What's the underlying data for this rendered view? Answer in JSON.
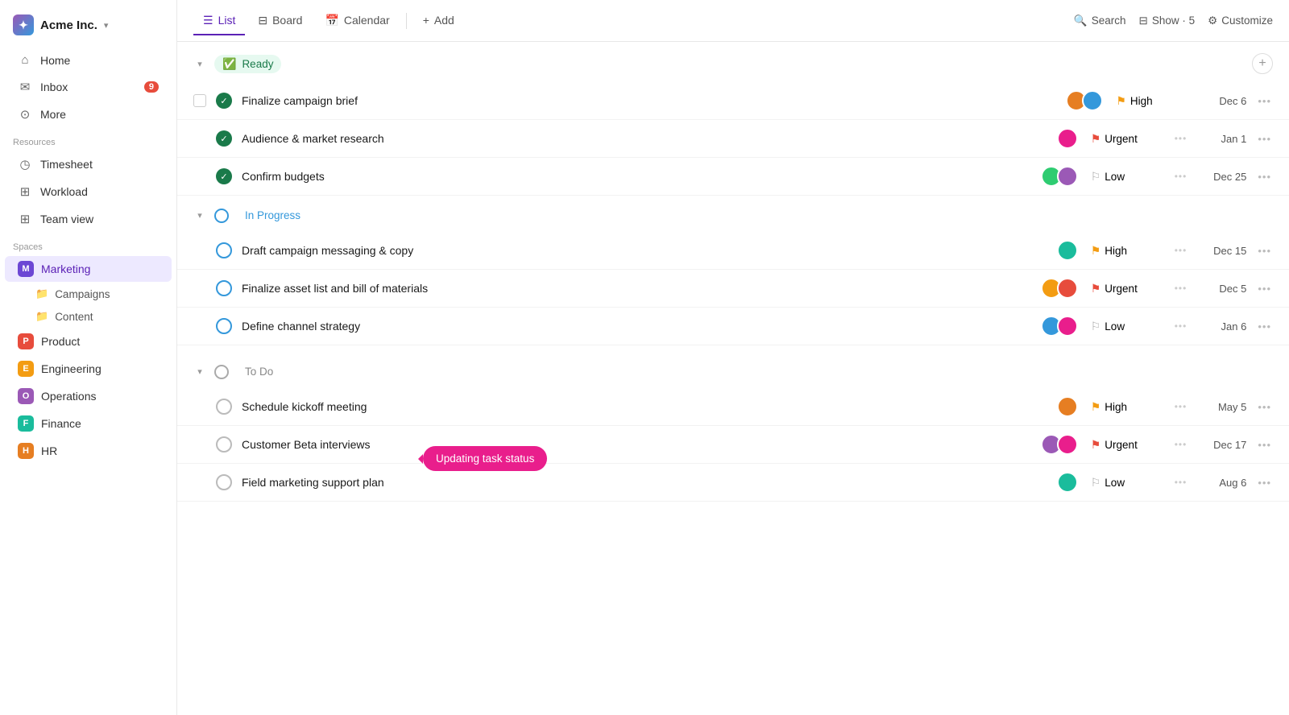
{
  "app": {
    "brand": "Acme Inc.",
    "brand_chevron": "▾"
  },
  "sidebar": {
    "nav_items": [
      {
        "id": "home",
        "label": "Home",
        "icon": "⌂"
      },
      {
        "id": "inbox",
        "label": "Inbox",
        "icon": "✉",
        "badge": "9"
      },
      {
        "id": "more",
        "label": "More",
        "icon": "⊙"
      }
    ],
    "resources_label": "Resources",
    "resource_items": [
      {
        "id": "timesheet",
        "label": "Timesheet",
        "icon": "◷"
      },
      {
        "id": "workload",
        "label": "Workload",
        "icon": "⊞"
      },
      {
        "id": "team-view",
        "label": "Team view",
        "icon": "⊞"
      }
    ],
    "spaces_label": "Spaces",
    "spaces": [
      {
        "id": "marketing",
        "label": "Marketing",
        "letter": "M",
        "color": "#6c47d4",
        "active": true
      },
      {
        "id": "product",
        "label": "Product",
        "letter": "P",
        "color": "#e74c3c"
      },
      {
        "id": "engineering",
        "label": "Engineering",
        "letter": "E",
        "color": "#f39c12"
      },
      {
        "id": "operations",
        "label": "Operations",
        "letter": "O",
        "color": "#9b59b6"
      },
      {
        "id": "finance",
        "label": "Finance",
        "letter": "F",
        "color": "#1abc9c"
      },
      {
        "id": "hr",
        "label": "HR",
        "letter": "H",
        "color": "#e67e22"
      }
    ],
    "sub_items": [
      {
        "id": "campaigns",
        "label": "Campaigns"
      },
      {
        "id": "content",
        "label": "Content"
      }
    ]
  },
  "topnav": {
    "tabs": [
      {
        "id": "list",
        "label": "List",
        "active": true
      },
      {
        "id": "board",
        "label": "Board",
        "active": false
      },
      {
        "id": "calendar",
        "label": "Calendar",
        "active": false
      }
    ],
    "add_label": "Add",
    "search_label": "Search",
    "show_label": "Show · 5",
    "customize_label": "Customize"
  },
  "groups": [
    {
      "id": "ready",
      "label": "Ready",
      "type": "ready",
      "tasks": [
        {
          "id": "t1",
          "name": "Finalize campaign brief",
          "priority": "High",
          "priority_type": "high",
          "date": "Dec 6",
          "avatars": [
            "a1",
            "a2"
          ],
          "has_checkbox": true,
          "status": "check"
        },
        {
          "id": "t2",
          "name": "Audience & market research",
          "priority": "Urgent",
          "priority_type": "urgent",
          "date": "Jan 1",
          "avatars": [
            "a3"
          ],
          "has_checkbox": false,
          "status": "check"
        },
        {
          "id": "t3",
          "name": "Confirm budgets",
          "priority": "Low",
          "priority_type": "low",
          "date": "Dec 25",
          "avatars": [
            "a4",
            "a5"
          ],
          "has_checkbox": false,
          "status": "check"
        }
      ]
    },
    {
      "id": "in-progress",
      "label": "In Progress",
      "type": "in-progress",
      "tasks": [
        {
          "id": "t4",
          "name": "Draft campaign messaging & copy",
          "priority": "High",
          "priority_type": "high",
          "date": "Dec 15",
          "avatars": [
            "a6"
          ],
          "status": "circle-blue"
        },
        {
          "id": "t5",
          "name": "Finalize asset list and bill of materials",
          "priority": "Urgent",
          "priority_type": "urgent",
          "date": "Dec 5",
          "avatars": [
            "a7",
            "a8"
          ],
          "status": "circle-blue"
        },
        {
          "id": "t6",
          "name": "Define channel strategy",
          "priority": "Low",
          "priority_type": "low",
          "date": "Jan 6",
          "avatars": [
            "a2",
            "a3"
          ],
          "status": "circle-blue"
        }
      ]
    },
    {
      "id": "to-do",
      "label": "To Do",
      "type": "to-do",
      "tasks": [
        {
          "id": "t7",
          "name": "Schedule kickoff meeting",
          "priority": "High",
          "priority_type": "high",
          "date": "May 5",
          "avatars": [
            "a1"
          ],
          "status": "circle-gray"
        },
        {
          "id": "t8",
          "name": "Customer Beta interviews",
          "priority": "Urgent",
          "priority_type": "urgent",
          "date": "Dec 17",
          "avatars": [
            "a5",
            "a3"
          ],
          "status": "circle-gray"
        },
        {
          "id": "t9",
          "name": "Field marketing support plan",
          "priority": "Low",
          "priority_type": "low",
          "date": "Aug 6",
          "avatars": [
            "a6"
          ],
          "status": "circle-gray"
        }
      ]
    }
  ],
  "tooltip": "Updating task status"
}
